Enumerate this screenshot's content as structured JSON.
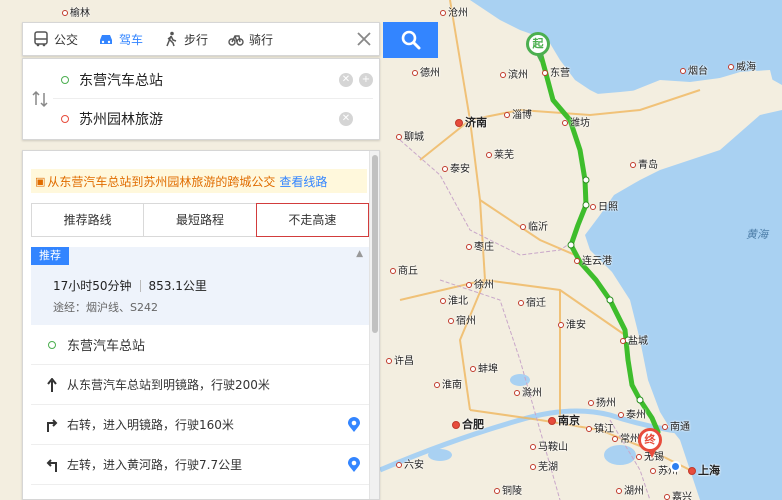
{
  "modes": [
    {
      "label": "公交",
      "icon": "bus-icon",
      "active": false
    },
    {
      "label": "驾车",
      "icon": "car-icon",
      "active": true
    },
    {
      "label": "步行",
      "icon": "walk-icon",
      "active": false
    },
    {
      "label": "骑行",
      "icon": "bike-icon",
      "active": false
    }
  ],
  "route": {
    "start": "东营汽车总站",
    "end": "苏州园林旅游"
  },
  "notice": {
    "text": "从东营汽车总站到苏州园林旅游的跨城公交",
    "link": "查看线路"
  },
  "tabs": [
    "推荐路线",
    "最短路程",
    "不走高速"
  ],
  "selected_tab": "不走高速",
  "recommend": {
    "tag": "推荐",
    "duration": "17小时50分钟",
    "distance": "853.1公里",
    "via": "途经：烟沪线、S242"
  },
  "steps": [
    {
      "type": "start",
      "text": "东营汽车总站"
    },
    {
      "type": "straight",
      "text": "从东营汽车总站到明镜路，行驶200米"
    },
    {
      "type": "right",
      "text": "右转，进入明镜路，行驶160米"
    },
    {
      "type": "left",
      "text": "左转，进入黄河路，行驶7.7公里"
    }
  ],
  "map": {
    "sea_label": "黄海",
    "start_pin": "起",
    "end_pin": "终",
    "cities": [
      {
        "name": "榆林",
        "big": false
      },
      {
        "name": "沧州",
        "big": false
      },
      {
        "name": "德州",
        "big": false
      },
      {
        "name": "滨州",
        "big": false
      },
      {
        "name": "东营",
        "big": false
      },
      {
        "name": "烟台",
        "big": false
      },
      {
        "name": "威海",
        "big": false
      },
      {
        "name": "济南",
        "big": true
      },
      {
        "name": "淄博",
        "big": false
      },
      {
        "name": "潍坊",
        "big": false
      },
      {
        "name": "聊城",
        "big": false
      },
      {
        "name": "泰安",
        "big": false
      },
      {
        "name": "莱芜",
        "big": false
      },
      {
        "name": "青岛",
        "big": false
      },
      {
        "name": "日照",
        "big": false
      },
      {
        "name": "临沂",
        "big": false
      },
      {
        "name": "枣庄",
        "big": false
      },
      {
        "name": "连云港",
        "big": false
      },
      {
        "name": "商丘",
        "big": false
      },
      {
        "name": "徐州",
        "big": false
      },
      {
        "name": "宿迁",
        "big": false
      },
      {
        "name": "淮北",
        "big": false
      },
      {
        "name": "宿州",
        "big": false
      },
      {
        "name": "淮安",
        "big": false
      },
      {
        "name": "盐城",
        "big": false
      },
      {
        "name": "蚌埠",
        "big": false
      },
      {
        "name": "淮南",
        "big": false
      },
      {
        "name": "滁州",
        "big": false
      },
      {
        "name": "扬州",
        "big": false
      },
      {
        "name": "泰州",
        "big": false
      },
      {
        "name": "南通",
        "big": false
      },
      {
        "name": "合肥",
        "big": true
      },
      {
        "name": "南京",
        "big": true
      },
      {
        "name": "镇江",
        "big": false
      },
      {
        "name": "常州",
        "big": false
      },
      {
        "name": "马鞍山",
        "big": false
      },
      {
        "name": "芜湖",
        "big": false
      },
      {
        "name": "无锡",
        "big": false
      },
      {
        "name": "苏州",
        "big": false
      },
      {
        "name": "上海",
        "big": true
      },
      {
        "name": "铜陵",
        "big": false
      },
      {
        "name": "湖州",
        "big": false
      },
      {
        "name": "嘉兴",
        "big": false
      },
      {
        "name": "许昌",
        "big": false
      },
      {
        "name": "六安",
        "big": false
      }
    ]
  },
  "colors": {
    "accent": "#3385ff",
    "route_line": "#3ebd2c",
    "start": "#4caf50",
    "end": "#e74c3c",
    "notice_text": "#e06c00"
  }
}
